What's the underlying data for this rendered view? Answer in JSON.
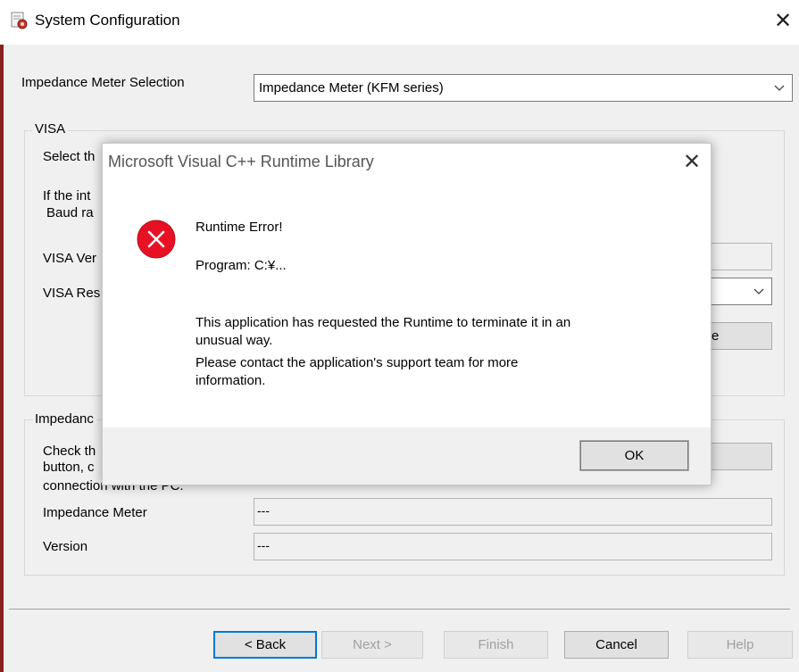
{
  "window": {
    "title": "System Configuration",
    "close_glyph": "✕",
    "icon": "app-gear-icon"
  },
  "meter_selection": {
    "label": "Impedance Meter Selection",
    "value": "Impedance Meter (KFM series)"
  },
  "visa_group": {
    "title": "VISA",
    "line1": "Select th",
    "line2": "If the int",
    "line3": "Baud ra",
    "version_label": "VISA Ver",
    "resource_label": "VISA Res",
    "button_tail": "e"
  },
  "impedance_group": {
    "title": "Impedanc",
    "check_line1": "Check th",
    "check_line2": "button, c",
    "check_line3": "connection with the PC.",
    "meter_label": "Impedance Meter",
    "meter_value": "---",
    "version_label": "Version",
    "version_value": "---"
  },
  "buttons": {
    "back": "< Back",
    "next": "Next >",
    "finish": "Finish",
    "cancel": "Cancel",
    "help": "Help"
  },
  "dialog": {
    "title": "Microsoft Visual C++ Runtime Library",
    "close_glyph": "✕",
    "icon": "error-icon",
    "heading": "Runtime Error!",
    "program": "Program: C:¥...",
    "message_line1": "This application has requested the Runtime to terminate it in an",
    "message_line2": "unusual way.",
    "message_line3": "Please contact the application's support team for more",
    "message_line4": "information.",
    "ok": "OK"
  },
  "colors": {
    "error_red": "#e81123",
    "focus_blue": "#0078d7"
  }
}
